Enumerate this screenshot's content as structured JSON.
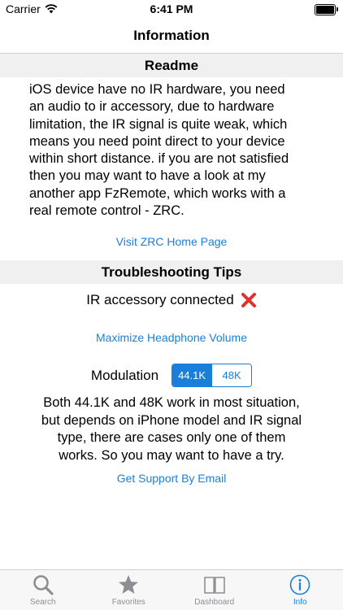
{
  "status_bar": {
    "carrier": "Carrier",
    "time": "6:41 PM"
  },
  "nav": {
    "title": "Information"
  },
  "readme": {
    "header": "Readme",
    "lines": [
      "iOS device have no IR hardware, you need",
      "an audio to ir accessory, due to hardware",
      "limitation, the IR signal is quite weak, which",
      "means you need point direct to your device",
      "within short distance. if you are not satisfied",
      "then you may want to have a look at my",
      "another app FzRemote, which works with a",
      "real remote control - ZRC."
    ],
    "link": "Visit ZRC Home Page"
  },
  "troubleshooting": {
    "header": "Troubleshooting Tips",
    "accessory_status": "IR accessory connected",
    "volume_link": "Maximize Headphone Volume",
    "modulation_label": "Modulation",
    "modulation_options": [
      "44.1K",
      "48K"
    ],
    "modulation_selected": "44.1K",
    "lines": [
      "Both 44.1K and 48K work in most situation,",
      "but depends on iPhone model and IR signal",
      "type, there are cases only one of them",
      "works. So you may want to have a try."
    ],
    "support_link": "Get Support By Email"
  },
  "tabs": [
    {
      "label": "Search",
      "icon": "search-icon"
    },
    {
      "label": "Favorites",
      "icon": "star-icon"
    },
    {
      "label": "Dashboard",
      "icon": "book-icon"
    },
    {
      "label": "Info",
      "icon": "info-icon"
    }
  ],
  "colors": {
    "accent": "#1a7fdb",
    "inactive": "#8e8e93",
    "error": "#e03030"
  }
}
